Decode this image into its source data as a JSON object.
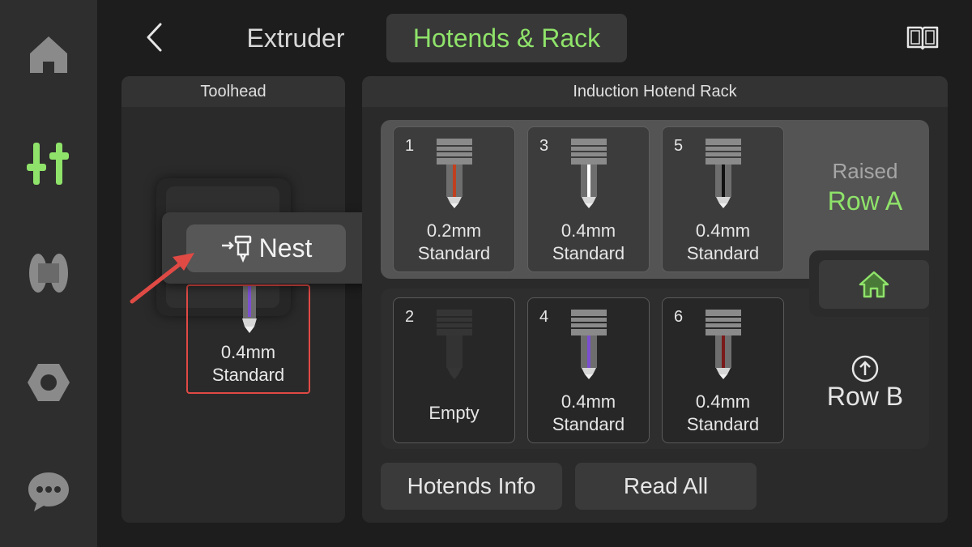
{
  "colors": {
    "accent": "#8fe36a",
    "highlight": "#e04a45",
    "background": "#1d1d1d"
  },
  "sidebar": {
    "items": [
      {
        "icon": "home-icon"
      },
      {
        "icon": "sliders-icon",
        "active": true
      },
      {
        "icon": "filament-spool-icon"
      },
      {
        "icon": "hex-nut-icon"
      },
      {
        "icon": "chat-icon"
      }
    ]
  },
  "header": {
    "back_icon": "chevron-left-icon",
    "tabs": [
      {
        "label": "Extruder",
        "active": false
      },
      {
        "label": "Hotends & Rack",
        "active": true
      }
    ],
    "manual_icon": "book-icon"
  },
  "toolhead": {
    "title": "Toolhead",
    "nest_label": "Nest",
    "nozzle": {
      "size": "0.4mm",
      "type": "Standard",
      "color": "#7b4fd0"
    }
  },
  "rack": {
    "title": "Induction Hotend Rack",
    "row_a": {
      "state_label": "Raised",
      "label": "Row A",
      "slots": [
        {
          "number": "1",
          "size": "0.2mm",
          "type": "Standard",
          "color": "#c0411f"
        },
        {
          "number": "3",
          "size": "0.4mm",
          "type": "Standard",
          "color": "#ffffff"
        },
        {
          "number": "5",
          "size": "0.4mm",
          "type": "Standard",
          "color": "#111111"
        }
      ]
    },
    "row_b": {
      "label": "Row B",
      "slots": [
        {
          "number": "2",
          "empty_label": "Empty"
        },
        {
          "number": "4",
          "size": "0.4mm",
          "type": "Standard",
          "color": "#7b4fd0"
        },
        {
          "number": "6",
          "size": "0.4mm",
          "type": "Standard",
          "color": "#7a1a1a"
        }
      ]
    }
  },
  "actions": {
    "info_label": "Hotends Info",
    "read_all_label": "Read All"
  }
}
